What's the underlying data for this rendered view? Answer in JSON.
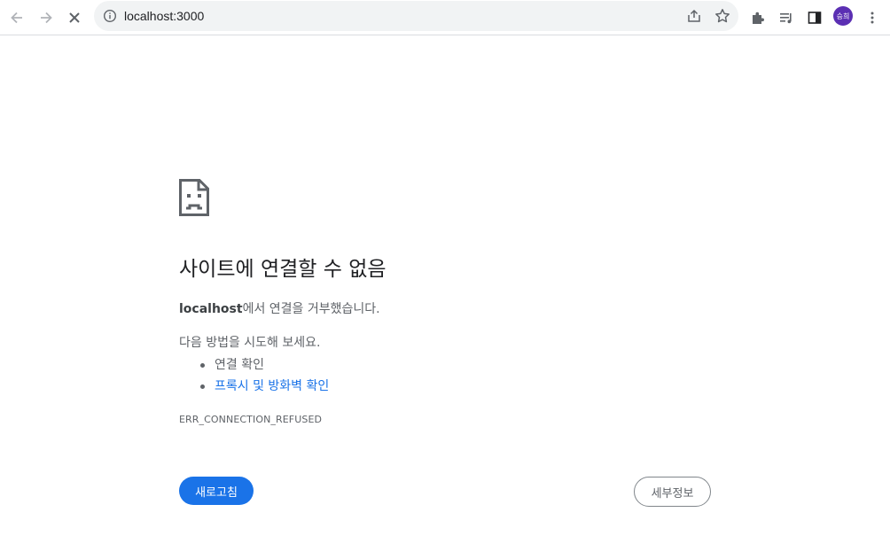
{
  "browser": {
    "url": "localhost:3000",
    "avatar_text": "승희",
    "colors": {
      "accent": "#1a73e8",
      "avatar_bg": "#5b2fb3"
    },
    "icons": [
      "back-arrow-icon",
      "forward-arrow-icon",
      "stop-icon",
      "info-icon",
      "share-icon",
      "star-icon",
      "extensions-icon",
      "reading-list-icon",
      "side-panel-icon",
      "menu-kebab-icon"
    ]
  },
  "error_page": {
    "icon": "sad-document-icon",
    "title": "사이트에 연결할 수 없음",
    "host": "localhost",
    "desc_suffix": "에서 연결을 거부했습니다.",
    "suggestions_title": "다음 방법을 시도해 보세요.",
    "suggestions": [
      {
        "label": "연결 확인",
        "is_link": false
      },
      {
        "label": "프록시 및 방화벽 확인",
        "is_link": true
      }
    ],
    "error_code": "ERR_CONNECTION_REFUSED",
    "reload_label": "새로고침",
    "details_label": "세부정보"
  }
}
